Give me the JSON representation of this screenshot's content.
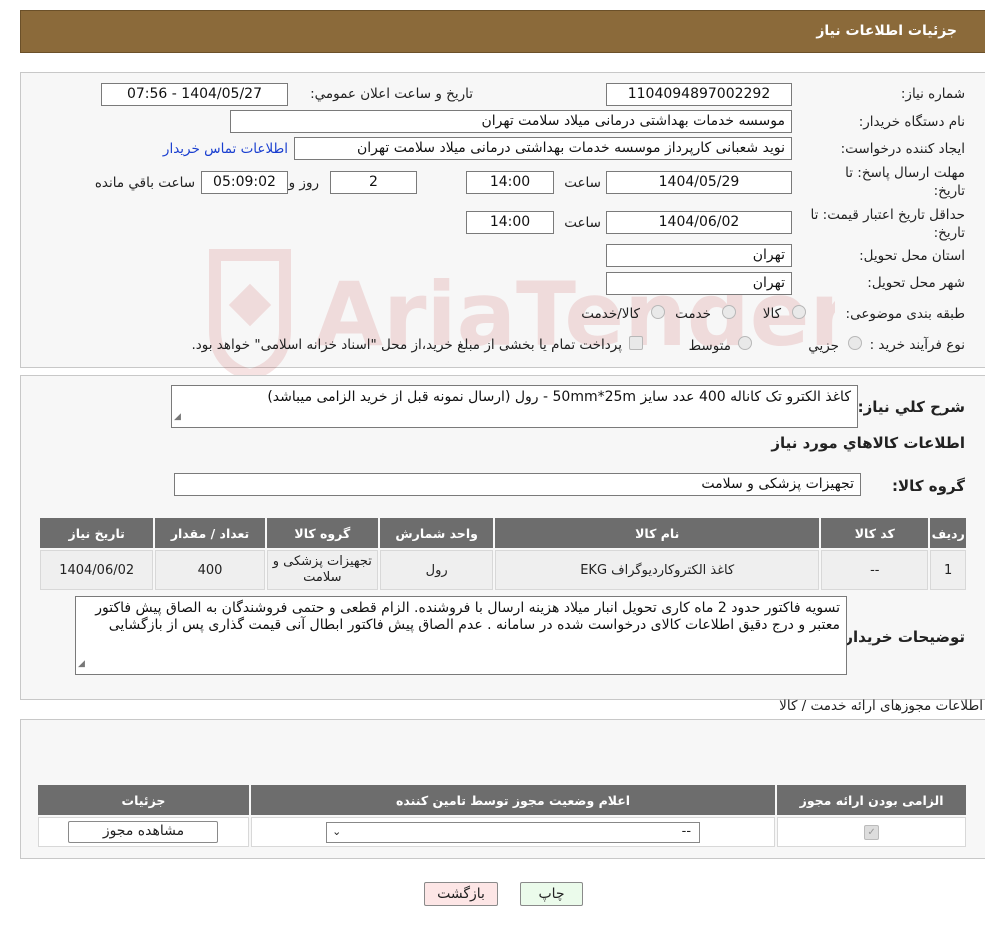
{
  "header": {
    "title": "جزئیات اطلاعات نیاز"
  },
  "watermark": {
    "text": "AriaTender.neT",
    "color": "#b71c1c"
  },
  "form": {
    "need_number_label": "شماره نیاز:",
    "need_number": "1104094897002292",
    "announce_label": "تاریخ و ساعت اعلان عمومي:",
    "announce_value": "1404/05/27 - 07:56",
    "buyer_label": "نام دستگاه خریدار:",
    "buyer_value": "موسسه خدمات بهداشتی درمانی میلاد سلامت تهران",
    "creator_label": "ایجاد کننده درخواست:",
    "creator_value": "نوید شعبانی کارپرداز موسسه خدمات بهداشتی درمانی میلاد سلامت تهران",
    "contact_link": "اطلاعات تماس خریدار",
    "deadline_label": "مهلت ارسال پاسخ: تا تاریخ:",
    "deadline_date": "1404/05/29",
    "time_label": "ساعت",
    "deadline_time": "14:00",
    "days_value": "2",
    "days_label": "روز و",
    "remaining_value": "05:09:02",
    "remaining_label": "ساعت باقي مانده",
    "validity_label": "حداقل تاریخ اعتبار قیمت: تا تاریخ:",
    "validity_date": "1404/06/02",
    "validity_time": "14:00",
    "province_label": "استان محل تحویل:",
    "province_value": "تهران",
    "city_label": "شهر محل تحویل:",
    "city_value": "تهران",
    "category_label": "طبقه بندی موضوعی:",
    "category_options": [
      "کالا",
      "خدمت",
      "کالا/خدمت"
    ],
    "process_label": "نوع فرآیند خرید :",
    "process_options": [
      "جزیي",
      "متوسط"
    ],
    "process_note": "پرداخت تمام یا بخشی از مبلغ خرید،از محل \"اسناد خزانه اسلامی\" خواهد بود."
  },
  "summary": {
    "label": "شرح کلي نیاز:",
    "text": "کاغذ الکترو تک کاناله 400 عدد  سایز 50mm*25m - رول  (ارسال نمونه قبل از خرید الزامی میباشد)"
  },
  "goods": {
    "section_title": "اطلاعات کالاهاي مورد نیاز",
    "group_label": "گروه کالا:",
    "group_value": "تجهیزات پزشکی و سلامت",
    "columns": [
      "ردیف",
      "کد کالا",
      "نام کالا",
      "واحد شمارش",
      "گروه کالا",
      "تعداد / مقدار",
      "تاریخ نیاز"
    ],
    "rows": [
      [
        "1",
        "--",
        "کاغذ الکتروکاردیوگراف EKG",
        "رول",
        "تجهیزات پزشکی و سلامت",
        "400",
        "1404/06/02"
      ]
    ]
  },
  "buyer_notes": {
    "label": "توضیحات خریدار:",
    "text": "تسویه فاکتور حدود 2 ماه کاری تحویل انبار میلاد هزینه ارسال با فروشنده. الزام قطعی و حتمی فروشندگان به الصاق پیش فاکتور معتبر و درج دقیق اطلاعات کالای درخواست شده در سامانه . عدم الصاق پیش فاکتور ابطال آنی قیمت گذاری پس از بازگشایی"
  },
  "permits": {
    "section_title": "اطلاعات مجوزهای ارائه خدمت / کالا",
    "columns": [
      "الزامی بودن ارائه مجوز",
      "اعلام وضعیت مجوز توسط تامین کننده",
      "جزئیات"
    ],
    "status_value": "--",
    "view_button": "مشاهده مجوز"
  },
  "actions": {
    "print": "چاپ",
    "back": "بازگشت"
  }
}
